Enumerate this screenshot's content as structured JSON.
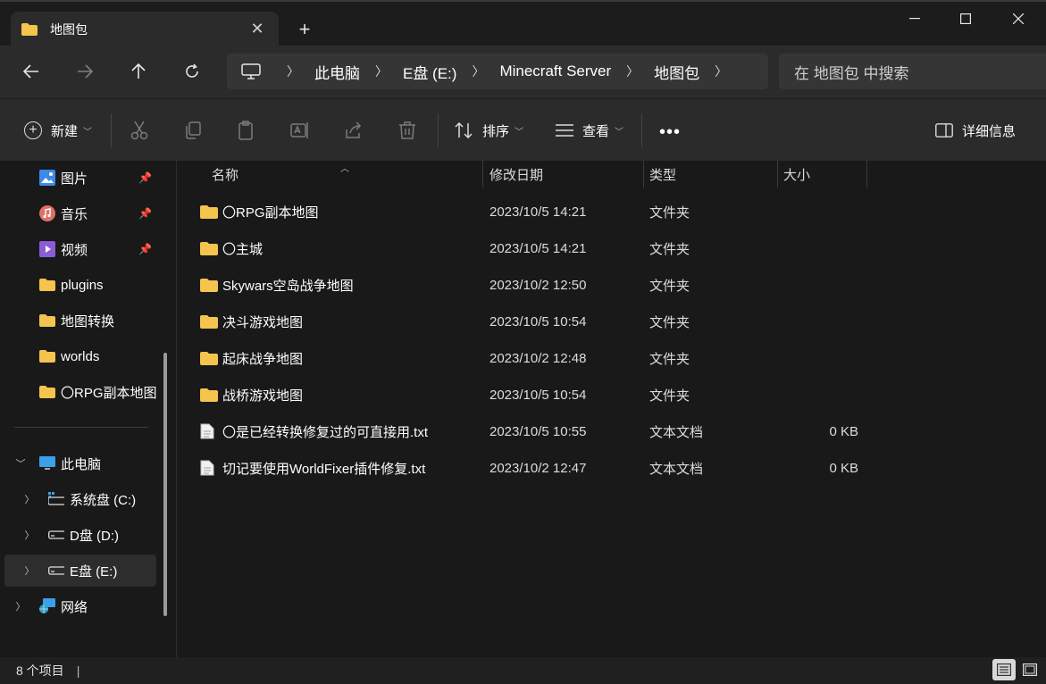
{
  "window": {
    "tab_title": "地图包",
    "tab_close_icon": "close-icon",
    "new_tab_icon": "plus-icon"
  },
  "address": {
    "breadcrumbs": [
      "此电脑",
      "E盘 (E:)",
      "Minecraft Server",
      "地图包"
    ],
    "search_placeholder": "在 地图包 中搜索"
  },
  "toolbar": {
    "new_label": "新建",
    "sort_label": "排序",
    "view_label": "查看",
    "more_label": "•••",
    "details_label": "详细信息"
  },
  "sidebar": {
    "quick_access": [
      {
        "label": "图片",
        "icon": "pictures-icon",
        "pinned": true
      },
      {
        "label": "音乐",
        "icon": "music-icon",
        "pinned": true
      },
      {
        "label": "视频",
        "icon": "videos-icon",
        "pinned": true
      },
      {
        "label": "plugins",
        "icon": "folder-icon",
        "pinned": false
      },
      {
        "label": "地图转换",
        "icon": "folder-icon",
        "pinned": false
      },
      {
        "label": "worlds",
        "icon": "folder-icon",
        "pinned": false
      },
      {
        "label": "〇RPG副本地图",
        "icon": "folder-icon",
        "pinned": false
      }
    ],
    "this_pc": {
      "label": "此电脑",
      "icon": "computer-icon"
    },
    "drives": [
      {
        "label": "系统盘 (C:)",
        "icon": "system-drive-icon"
      },
      {
        "label": "D盘 (D:)",
        "icon": "drive-icon"
      },
      {
        "label": "E盘 (E:)",
        "icon": "drive-icon"
      }
    ],
    "network": {
      "label": "网络",
      "icon": "network-icon"
    }
  },
  "columns": {
    "name": "名称",
    "modified": "修改日期",
    "type": "类型",
    "size": "大小"
  },
  "files": [
    {
      "name": "〇RPG副本地图",
      "modified": "2023/10/5 14:21",
      "type": "文件夹",
      "size": "",
      "icon": "folder-icon"
    },
    {
      "name": "〇主城",
      "modified": "2023/10/5 14:21",
      "type": "文件夹",
      "size": "",
      "icon": "folder-icon"
    },
    {
      "name": "Skywars空岛战争地图",
      "modified": "2023/10/2 12:50",
      "type": "文件夹",
      "size": "",
      "icon": "folder-icon"
    },
    {
      "name": "决斗游戏地图",
      "modified": "2023/10/5 10:54",
      "type": "文件夹",
      "size": "",
      "icon": "folder-icon"
    },
    {
      "name": "起床战争地图",
      "modified": "2023/10/2 12:48",
      "type": "文件夹",
      "size": "",
      "icon": "folder-icon"
    },
    {
      "name": "战桥游戏地图",
      "modified": "2023/10/5 10:54",
      "type": "文件夹",
      "size": "",
      "icon": "folder-icon"
    },
    {
      "name": "〇是已经转换修复过的可直接用.txt",
      "modified": "2023/10/5 10:55",
      "type": "文本文档",
      "size": "0 KB",
      "icon": "text-file-icon"
    },
    {
      "name": "切记要使用WorldFixer插件修复.txt",
      "modified": "2023/10/2 12:47",
      "type": "文本文档",
      "size": "0 KB",
      "icon": "text-file-icon"
    }
  ],
  "status": {
    "item_count": "8 个项目",
    "separator": "|"
  },
  "colors": {
    "folder": "#f4c44e",
    "background": "#191919",
    "toolbar": "#2b2b2b"
  }
}
